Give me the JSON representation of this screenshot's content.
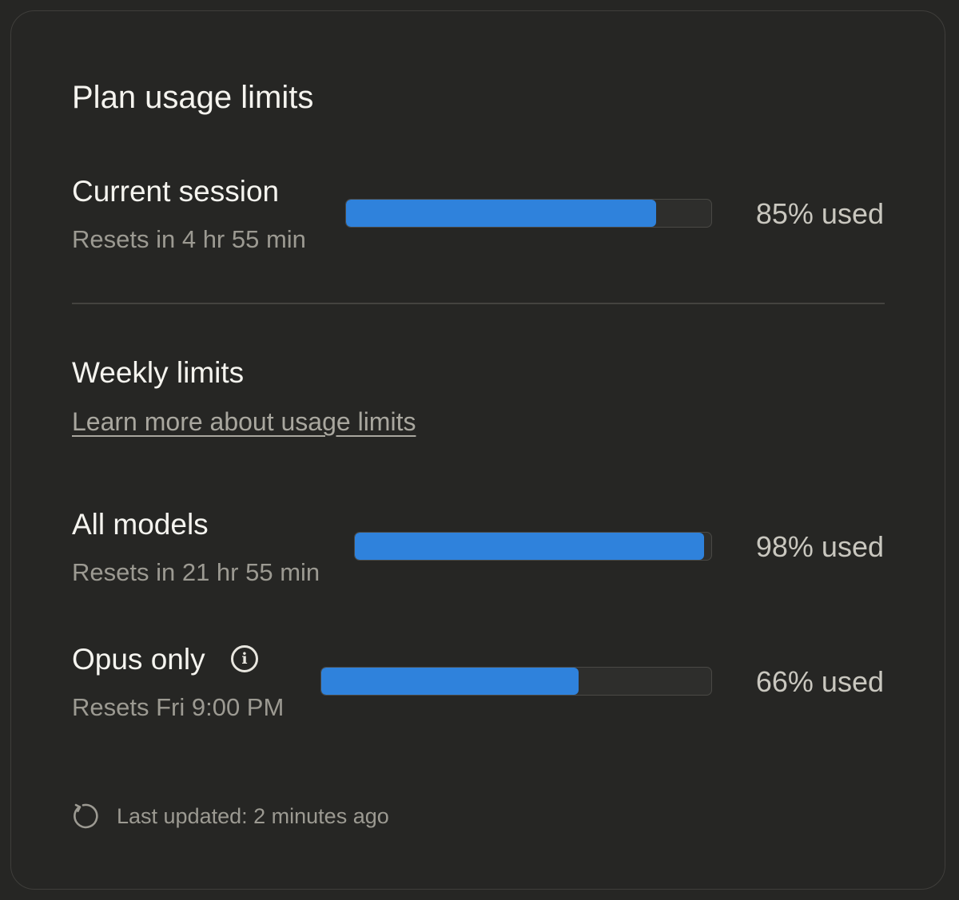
{
  "panel": {
    "title": "Plan usage limits"
  },
  "current_session": {
    "title": "Current session",
    "subtitle": "Resets in 4 hr 55 min",
    "percent_used": 85,
    "percent_label": "85% used"
  },
  "weekly": {
    "heading": "Weekly limits",
    "learn_more_link": "Learn more about usage limits",
    "items": [
      {
        "title": "All models",
        "subtitle": "Resets in 21 hr 55 min",
        "percent_used": 98,
        "percent_label": "98% used"
      },
      {
        "title": "Opus only",
        "subtitle": "Resets Fri 9:00 PM",
        "percent_used": 66,
        "percent_label": "66% used",
        "icon": "info-icon"
      }
    ]
  },
  "footer": {
    "icon": "refresh-icon",
    "last_updated": "Last updated: 2 minutes ago"
  },
  "colors": {
    "background": "#262624",
    "bar_fill": "#2f82dc",
    "bar_track": "#2e2e2c",
    "text_primary": "#f5f4ef",
    "text_secondary": "#9c9a92"
  }
}
